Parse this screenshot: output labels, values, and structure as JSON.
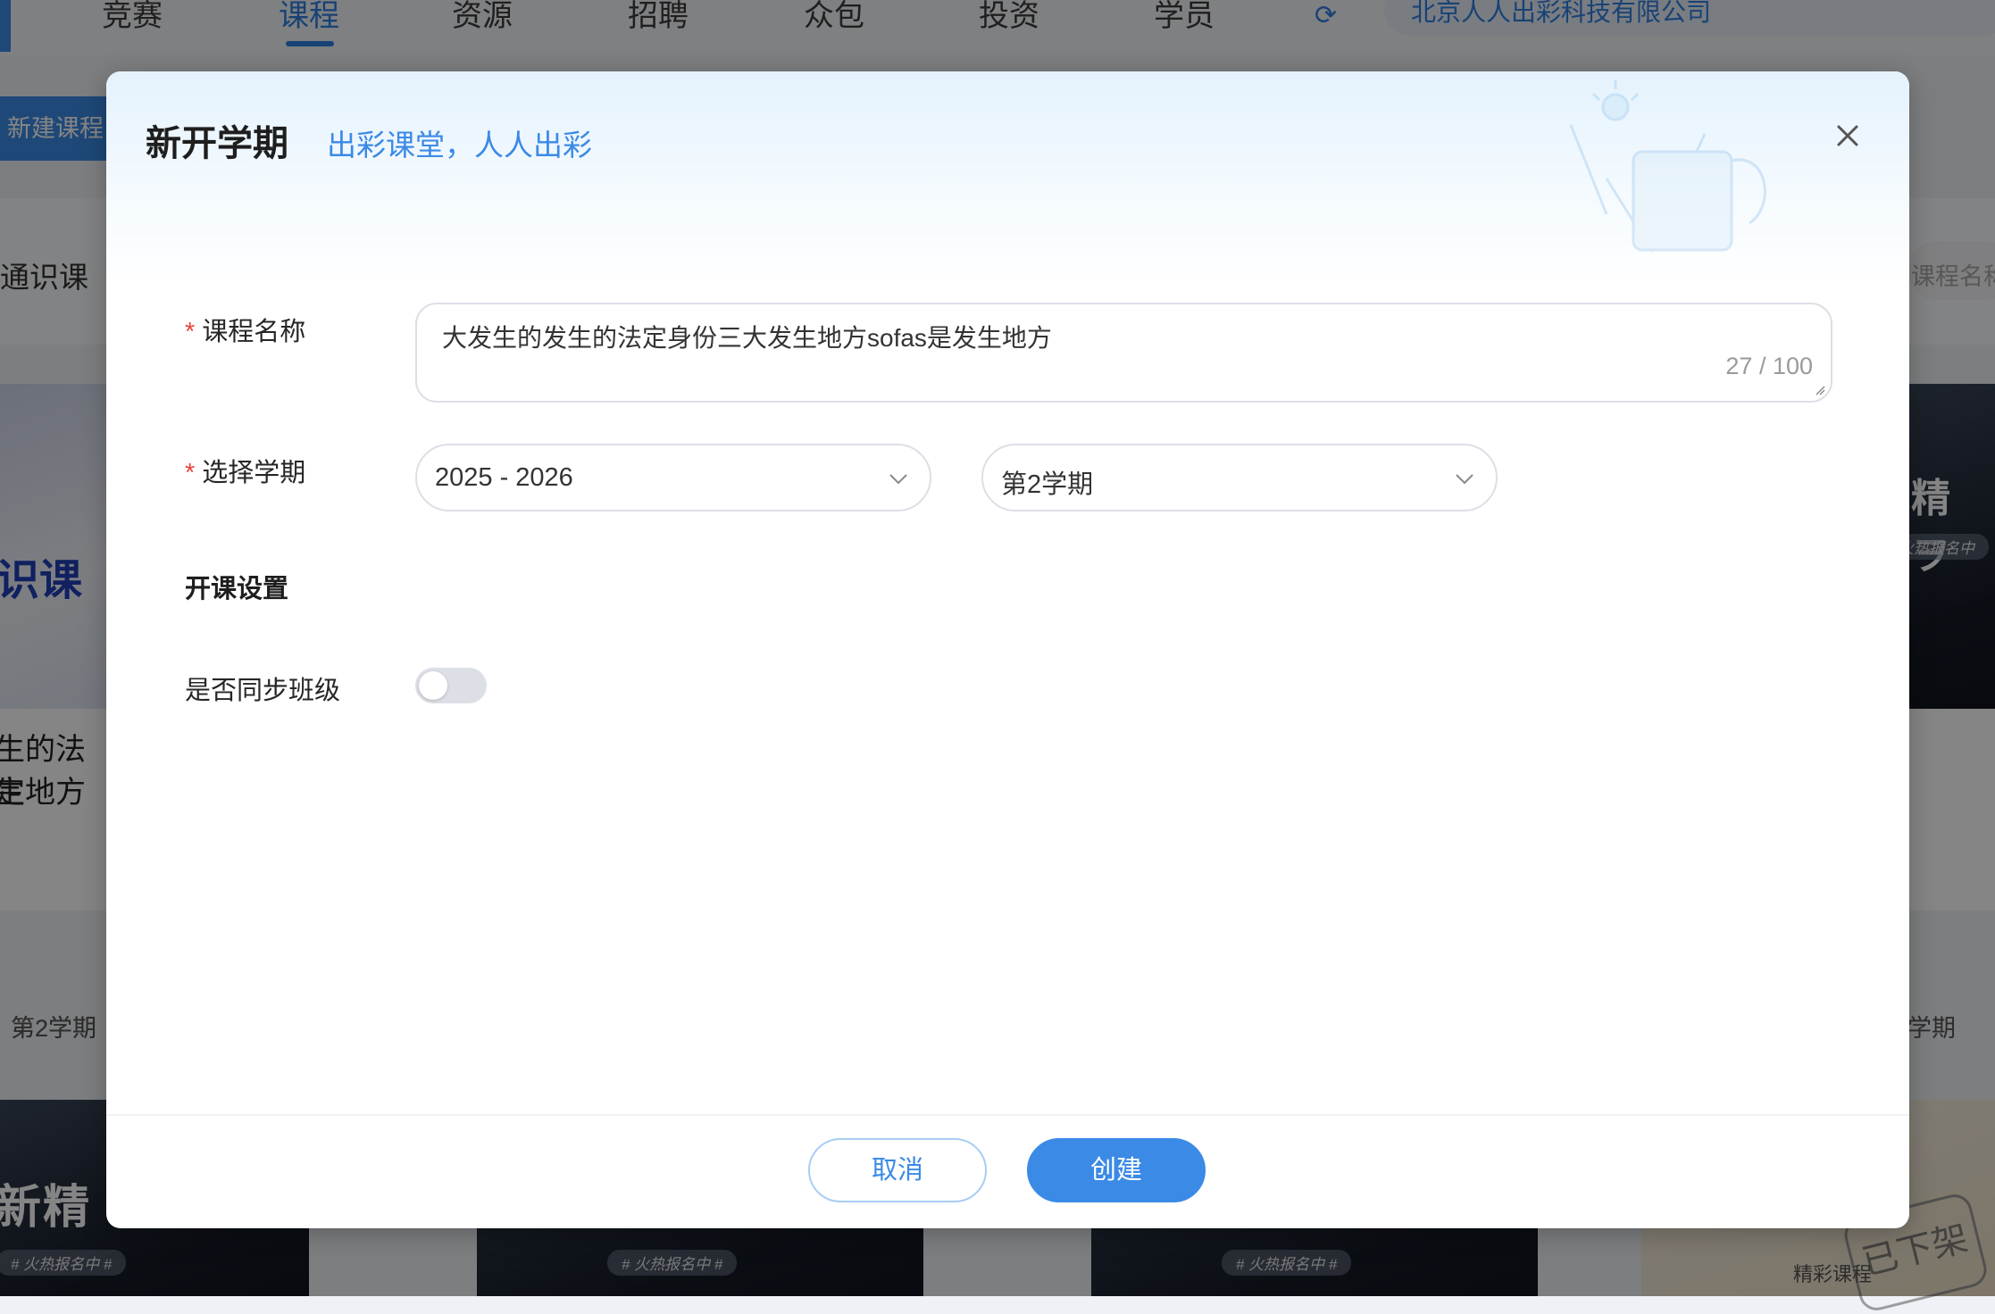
{
  "nav": {
    "items": [
      "竞赛",
      "课程",
      "资源",
      "招聘",
      "众包",
      "投资",
      "学员"
    ],
    "active": "课程",
    "org_name": "北京人人出彩科技有限公司"
  },
  "background": {
    "new_course_label": "新建课程",
    "tab_label": "通识课",
    "search_placeholder": "课程名称",
    "card1_cover_text": "识课",
    "card1_title_line1": "生的法定",
    "card1_title_line2": "生地方",
    "card1_term": "第2学期",
    "right_card_cover_text": "精 ヲ",
    "right_card_pill": "火热报名中",
    "right_card_term": "学期",
    "bottom_cover_text": "新精",
    "bottom_pill": "# 火热报名中 #",
    "stamp_text": "已下架",
    "stamp_sub": "精彩课程"
  },
  "dialog": {
    "title": "新开学期",
    "subtitle": "出彩课堂，人人出彩",
    "course_name_label": "课程名称",
    "course_name_value": "大发生的发生的法定身份三大发生地方sofas是发生地方",
    "course_name_counter": "27 / 100",
    "term_label": "选择学期",
    "year_value": "2025 - 2026",
    "semester_value": "第2学期",
    "settings_title": "开课设置",
    "sync_label": "是否同步班级",
    "sync_enabled": false,
    "cancel_label": "取消",
    "create_label": "创建"
  },
  "colors": {
    "accent": "#3b8ae6",
    "required": "#e8453c",
    "overlay": "rgba(0,0,0,0.48)"
  }
}
